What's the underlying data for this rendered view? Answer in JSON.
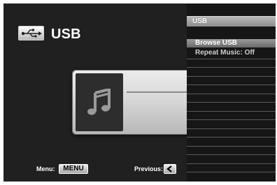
{
  "source": {
    "title": "USB",
    "icon": "usb-drive-icon"
  },
  "now_playing": {
    "art_icon": "music-note-icon"
  },
  "panel": {
    "header": "USB",
    "items": [
      {
        "label": "Browse USB",
        "selected": true
      },
      {
        "label": "Repeat Music: Off",
        "selected": false
      }
    ]
  },
  "footer": {
    "menu_label": "Menu:",
    "menu_key": "MENU",
    "previous_label": "Previous:",
    "previous_key_icon": "chevron-left-icon"
  },
  "colors": {
    "background": "#202020",
    "panel_background": "#161616",
    "highlight": "#8a8a8a",
    "text": "#ffffff"
  }
}
